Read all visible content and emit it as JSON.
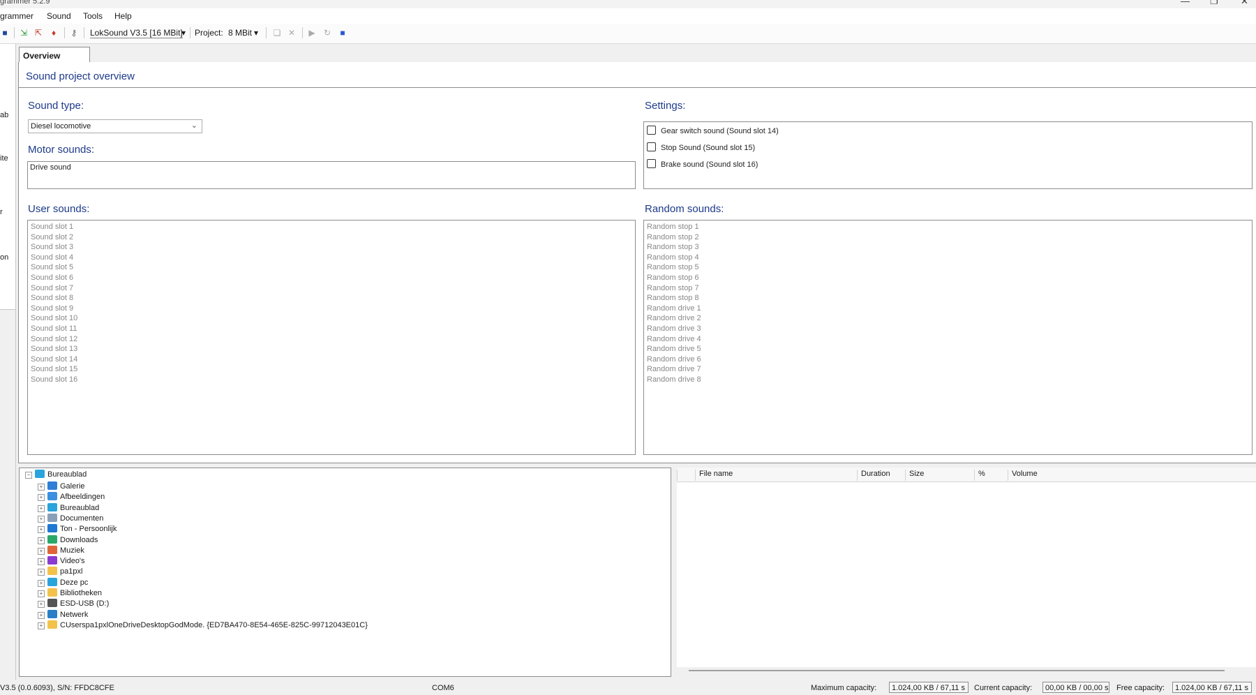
{
  "window": {
    "title": "grammer 5.2.9"
  },
  "menu": [
    "grammer",
    "Sound",
    "Tools",
    "Help"
  ],
  "toolbar": {
    "decoder": "LokSound V3.5 [16 MBit]",
    "project_label": "Project:",
    "project_value": "8 MBit"
  },
  "left_strip": [
    "ab",
    "ite",
    "r",
    "on"
  ],
  "tab": {
    "label": "Overview"
  },
  "panel": {
    "title": "Sound project overview"
  },
  "sound_type": {
    "label": "Sound type:",
    "value": "Diesel locomotive"
  },
  "motor_sounds": {
    "label": "Motor sounds:",
    "value": "Drive sound"
  },
  "settings": {
    "label": "Settings:",
    "items": [
      "Gear switch sound (Sound slot 14)",
      "Stop Sound (Sound slot 15)",
      "Brake sound (Sound slot 16)"
    ]
  },
  "user_sounds": {
    "label": "User sounds:",
    "items": [
      "Sound slot 1",
      "Sound slot 2",
      "Sound slot 3",
      "Sound slot 4",
      "Sound slot 5",
      "Sound slot 6",
      "Sound slot 7",
      "Sound slot 8",
      "Sound slot 9",
      "Sound slot 10",
      "Sound slot 11",
      "Sound slot 12",
      "Sound slot 13",
      "Sound slot 14",
      "Sound slot 15",
      "Sound slot 16"
    ]
  },
  "random_sounds": {
    "label": "Random sounds:",
    "items": [
      "Random stop 1",
      "Random stop 2",
      "Random stop 3",
      "Random stop 4",
      "Random stop 5",
      "Random stop 6",
      "Random stop 7",
      "Random stop 8",
      "Random drive 1",
      "Random drive 2",
      "Random drive 3",
      "Random drive 4",
      "Random drive 5",
      "Random drive 6",
      "Random drive 7",
      "Random drive 8"
    ]
  },
  "tree": {
    "root": "Bureaublad",
    "items": [
      {
        "label": "Galerie",
        "icon": "gallery-icon",
        "color": "#2f7fd6"
      },
      {
        "label": "Afbeeldingen",
        "icon": "pictures-icon",
        "color": "#3a8fe0"
      },
      {
        "label": "Bureaublad",
        "icon": "desktop-icon",
        "color": "#2aa4dc"
      },
      {
        "label": "Documenten",
        "icon": "documents-icon",
        "color": "#8aa0b8"
      },
      {
        "label": "Ton - Persoonlijk",
        "icon": "onedrive-icon",
        "color": "#1e78d4"
      },
      {
        "label": "Downloads",
        "icon": "downloads-icon",
        "color": "#2aa86a"
      },
      {
        "label": "Muziek",
        "icon": "music-icon",
        "color": "#e0643a"
      },
      {
        "label": "Video's",
        "icon": "videos-icon",
        "color": "#8a3ad0"
      },
      {
        "label": "pa1pxl",
        "icon": "folder-icon",
        "color": "#f2c24a"
      },
      {
        "label": "Deze pc",
        "icon": "computer-icon",
        "color": "#2aa4dc"
      },
      {
        "label": "Bibliotheken",
        "icon": "libraries-icon",
        "color": "#f2c24a"
      },
      {
        "label": "ESD-USB (D:)",
        "icon": "drive-icon",
        "color": "#555555"
      },
      {
        "label": "Netwerk",
        "icon": "network-icon",
        "color": "#2a7fc8"
      },
      {
        "label": "CUserspa1pxlOneDriveDesktopGodMode. {ED7BA470-8E54-465E-825C-99712043E01C}",
        "icon": "folder-icon",
        "color": "#f2c24a"
      }
    ]
  },
  "files": {
    "columns": [
      "File name",
      "Duration",
      "Size",
      "%",
      "Volume"
    ]
  },
  "status": {
    "device": "V3.5 (0.0.6093), S/N: FFDC8CFE",
    "port": "COM6",
    "max_label": "Maximum capacity:",
    "max_value": "1.024,00 KB / 67,11 s",
    "cur_label": "Current capacity:",
    "cur_value": "00,00 KB / 00,00 s",
    "free_label": "Free capacity:",
    "free_value": "1.024,00 KB / 67,11 s"
  }
}
